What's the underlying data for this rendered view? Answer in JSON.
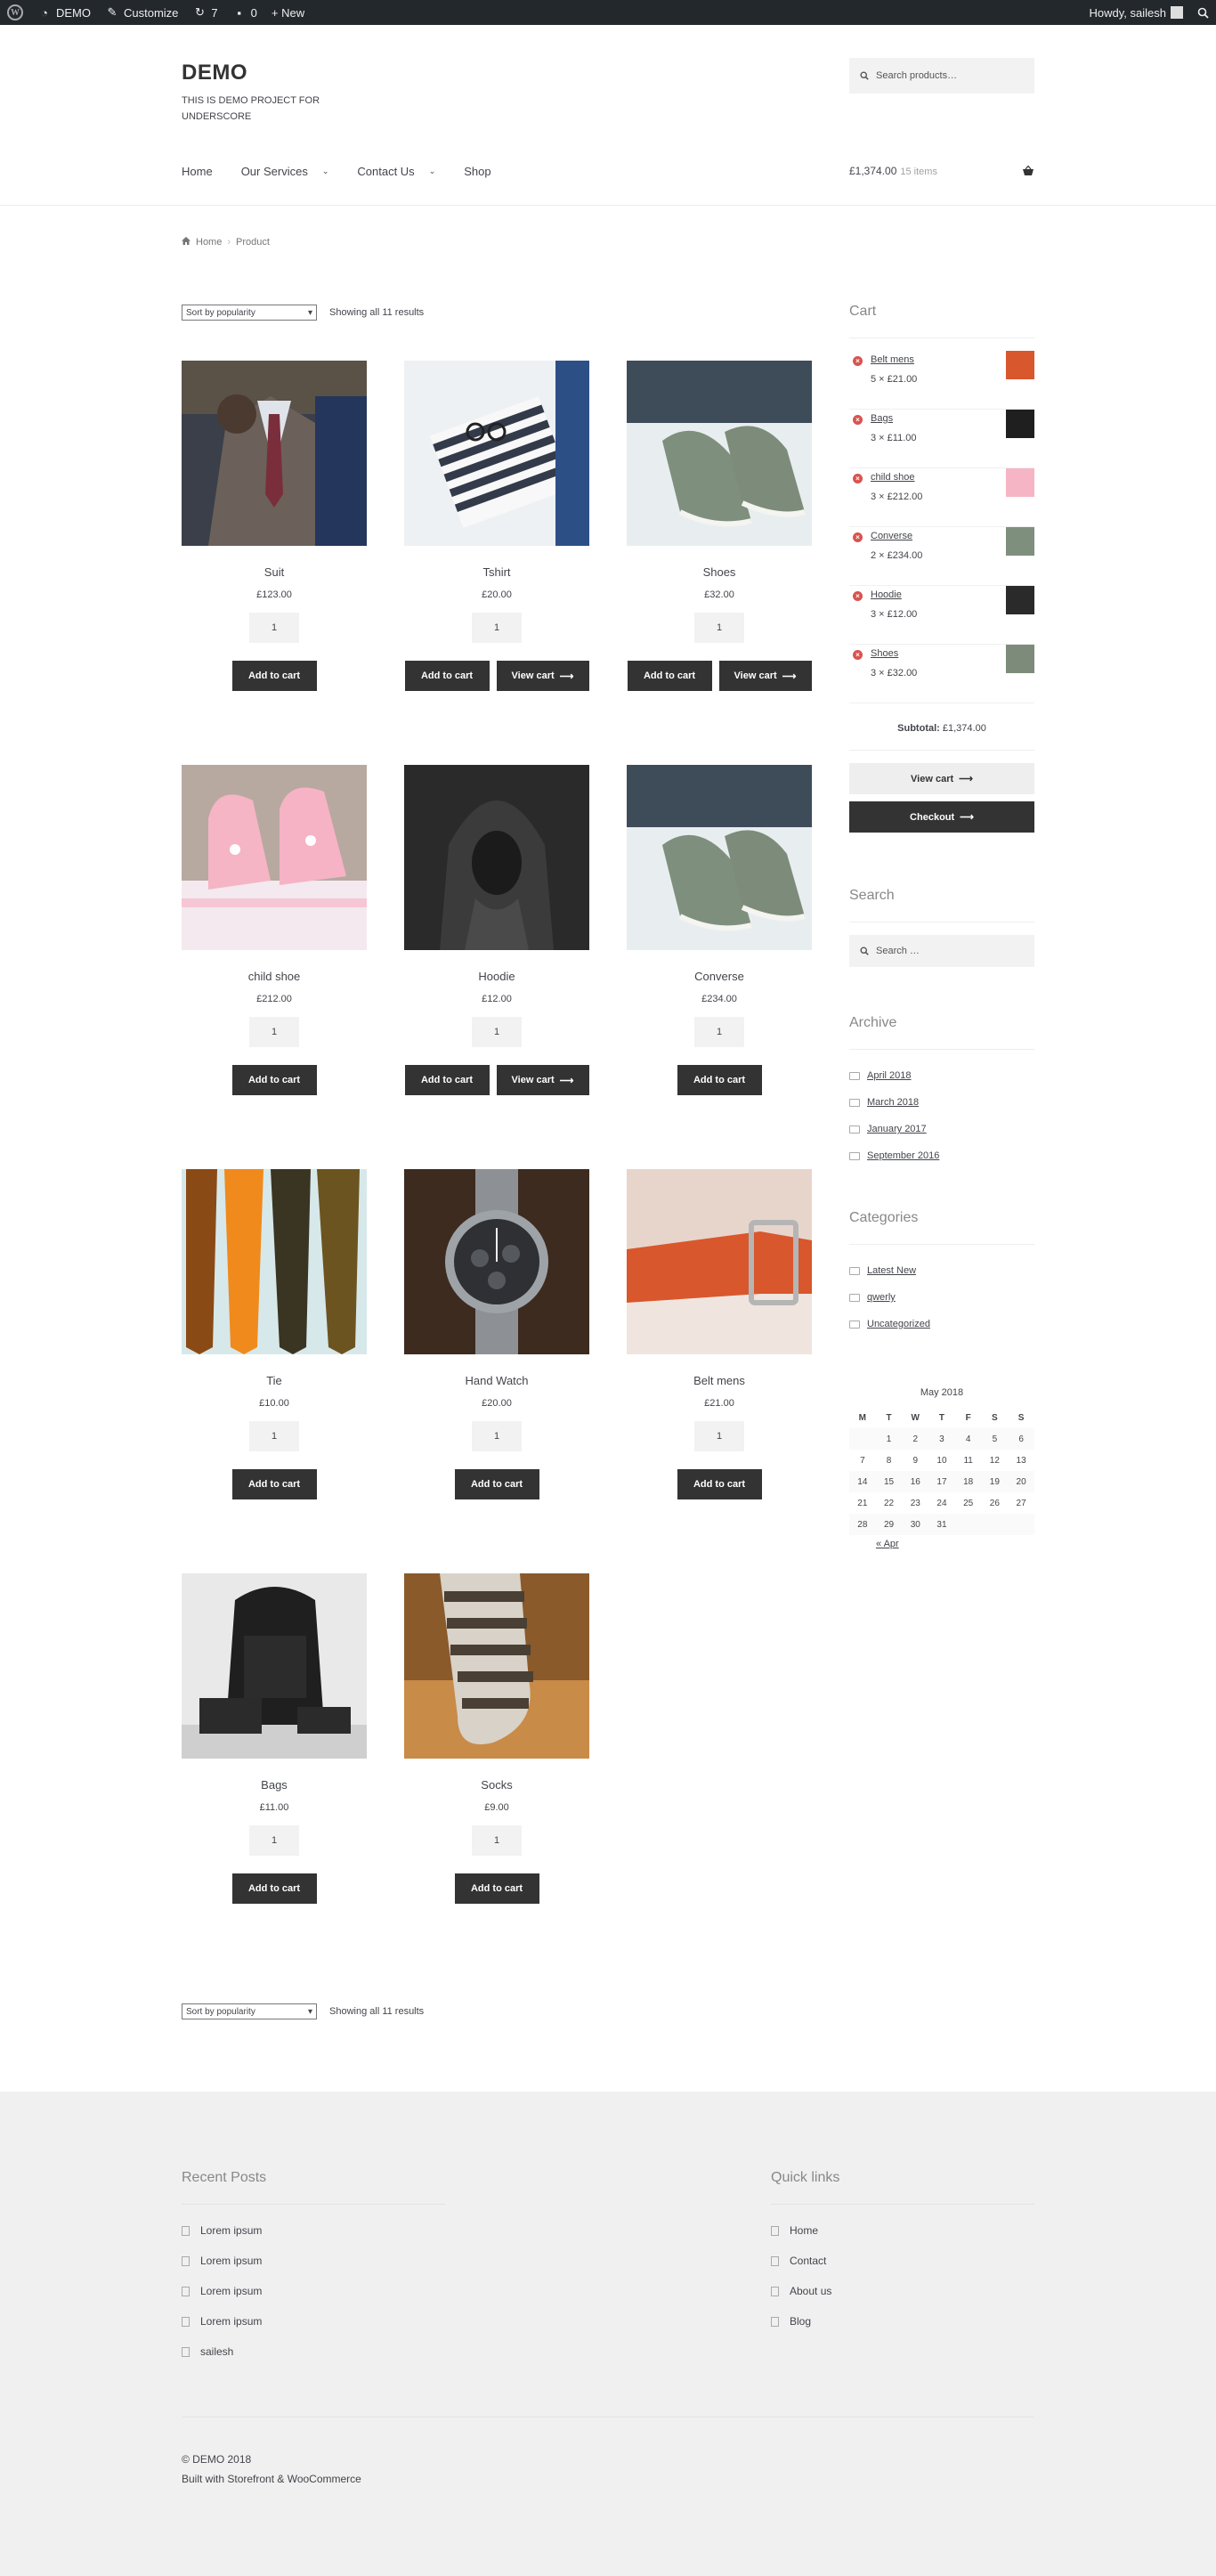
{
  "adminbar": {
    "site": "DEMO",
    "customize": "Customize",
    "updates": "7",
    "comments": "0",
    "new": "+ New",
    "howdy": "Howdy, sailesh"
  },
  "header": {
    "title": "DEMO",
    "description": "THIS IS DEMO PROJECT FOR UNDERSCORE",
    "search_placeholder": "Search products…",
    "nav": [
      "Home",
      "Our Services",
      "Contact Us",
      "Shop"
    ],
    "cart_total": "£1,374.00",
    "cart_count": "15 items"
  },
  "breadcrumb": {
    "home": "Home",
    "current": "Product"
  },
  "sorting": {
    "select": "Sort by popularity",
    "result": "Showing all 11 results"
  },
  "buttons": {
    "add": "Add to cart",
    "view": "View cart"
  },
  "products": [
    {
      "name": "Suit",
      "price": "£123.00",
      "qty": "1",
      "view": false
    },
    {
      "name": "Tshirt",
      "price": "£20.00",
      "qty": "1",
      "view": true
    },
    {
      "name": "Shoes",
      "price": "£32.00",
      "qty": "1",
      "view": true
    },
    {
      "name": "child shoe",
      "price": "£212.00",
      "qty": "1",
      "view": false
    },
    {
      "name": "Hoodie",
      "price": "£12.00",
      "qty": "1",
      "view": true
    },
    {
      "name": "Converse",
      "price": "£234.00",
      "qty": "1",
      "view": false
    },
    {
      "name": "Tie",
      "price": "£10.00",
      "qty": "1",
      "view": false
    },
    {
      "name": "Hand Watch",
      "price": "£20.00",
      "qty": "1",
      "view": false
    },
    {
      "name": "Belt mens",
      "price": "£21.00",
      "qty": "1",
      "view": false
    },
    {
      "name": "Bags",
      "price": "£11.00",
      "qty": "1",
      "view": false
    },
    {
      "name": "Socks",
      "price": "£9.00",
      "qty": "1",
      "view": false
    }
  ],
  "sidebar": {
    "cart_title": "Cart",
    "cart_items": [
      {
        "name": "Belt mens",
        "qty": "5 × £21.00"
      },
      {
        "name": "Bags",
        "qty": "3 × £11.00"
      },
      {
        "name": "child shoe",
        "qty": "3 × £212.00"
      },
      {
        "name": "Converse",
        "qty": "2 × £234.00"
      },
      {
        "name": "Hoodie",
        "qty": "3 × £12.00"
      },
      {
        "name": "Shoes",
        "qty": "3 × £32.00"
      }
    ],
    "subtotal_label": "Subtotal:",
    "subtotal_value": "£1,374.00",
    "view_cart": "View cart",
    "checkout": "Checkout",
    "search_title": "Search",
    "search_placeholder": "Search …",
    "archive_title": "Archive",
    "archive": [
      "April 2018",
      "March 2018",
      "January 2017",
      "September 2016"
    ],
    "categories_title": "Categories",
    "categories": [
      "Latest New",
      "qwerly",
      "Uncategorized"
    ],
    "calendar": {
      "caption": "May 2018",
      "days": [
        "M",
        "T",
        "W",
        "T",
        "F",
        "S",
        "S"
      ],
      "weeks": [
        [
          "",
          "1",
          "2",
          "3",
          "4",
          "5",
          "6"
        ],
        [
          "7",
          "8",
          "9",
          "10",
          "11",
          "12",
          "13"
        ],
        [
          "14",
          "15",
          "16",
          "17",
          "18",
          "19",
          "20"
        ],
        [
          "21",
          "22",
          "23",
          "24",
          "25",
          "26",
          "27"
        ],
        [
          "28",
          "29",
          "30",
          "31",
          "",
          "",
          ""
        ]
      ],
      "prev": "« Apr"
    }
  },
  "footer": {
    "recent_title": "Recent Posts",
    "recent": [
      "Lorem ipsum",
      "Lorem ipsum",
      "Lorem ipsum",
      "Lorem ipsum",
      "sailesh"
    ],
    "quick_title": "Quick links",
    "quick": [
      "Home",
      "Contact",
      "About us",
      "Blog"
    ],
    "copyright": "© DEMO 2018",
    "built": "Built with Storefront & WooCommerce"
  },
  "colors": {
    "accent": "#333333",
    "remove": "#d9534f",
    "footer_bg": "#f0f0f0",
    "adminbar": "#23282d"
  }
}
